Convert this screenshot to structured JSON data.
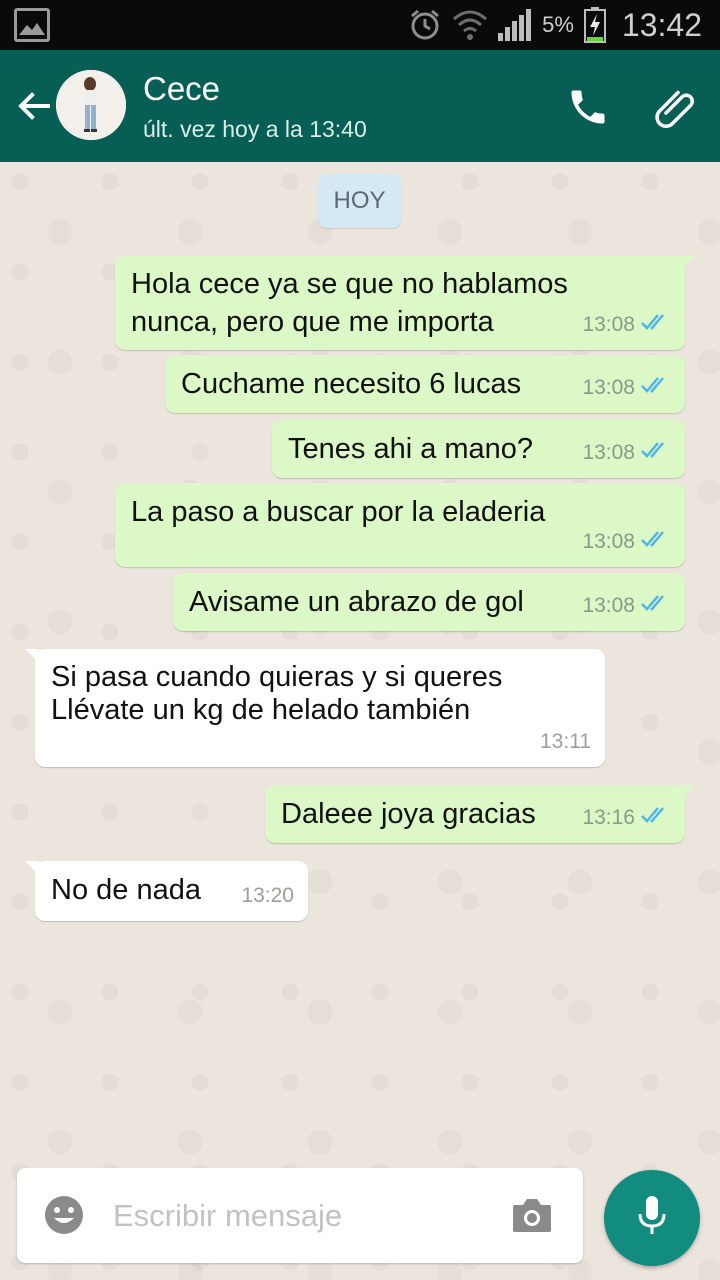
{
  "status_bar": {
    "battery_percent": "5%",
    "time": "13:42",
    "icons": [
      "gallery-icon",
      "alarm-icon",
      "wifi-icon",
      "signal-icon",
      "battery-charging-icon"
    ]
  },
  "header": {
    "contact_name": "Cece",
    "last_seen": "últ. vez hoy a la 13:40",
    "icons": [
      "back-arrow-icon",
      "avatar",
      "phone-icon",
      "paperclip-icon"
    ]
  },
  "chat": {
    "date_chip": "HOY",
    "messages": [
      {
        "direction": "out",
        "text": "Hola cece ya se que no hablamos\nnunca, pero que me importa",
        "time": "13:08",
        "status": "read"
      },
      {
        "direction": "out",
        "text": "Cuchame necesito 6 lucas",
        "time": "13:08",
        "status": "read"
      },
      {
        "direction": "out",
        "text": "Tenes ahi a mano?",
        "time": "13:08",
        "status": "read"
      },
      {
        "direction": "out",
        "text": "La paso a buscar por la eladeria",
        "time": "13:08",
        "status": "read"
      },
      {
        "direction": "out",
        "text": "Avisame un abrazo de gol",
        "time": "13:08",
        "status": "read"
      },
      {
        "direction": "in",
        "text": "Si pasa cuando quieras y si queres\nLlévate un kg de helado también",
        "time": "13:11"
      },
      {
        "direction": "out",
        "text": "Daleee joya gracias",
        "time": "13:16",
        "status": "read"
      },
      {
        "direction": "in",
        "text": "No de nada",
        "time": "13:20"
      }
    ]
  },
  "composer": {
    "placeholder": "Escribir mensaje",
    "value": ""
  },
  "colors": {
    "header_bg": "#075e54",
    "outgoing_bubble": "#dcf8c6",
    "incoming_bubble": "#ffffff",
    "read_ticks": "#4fb6ec",
    "mic_button": "#128c7e"
  }
}
